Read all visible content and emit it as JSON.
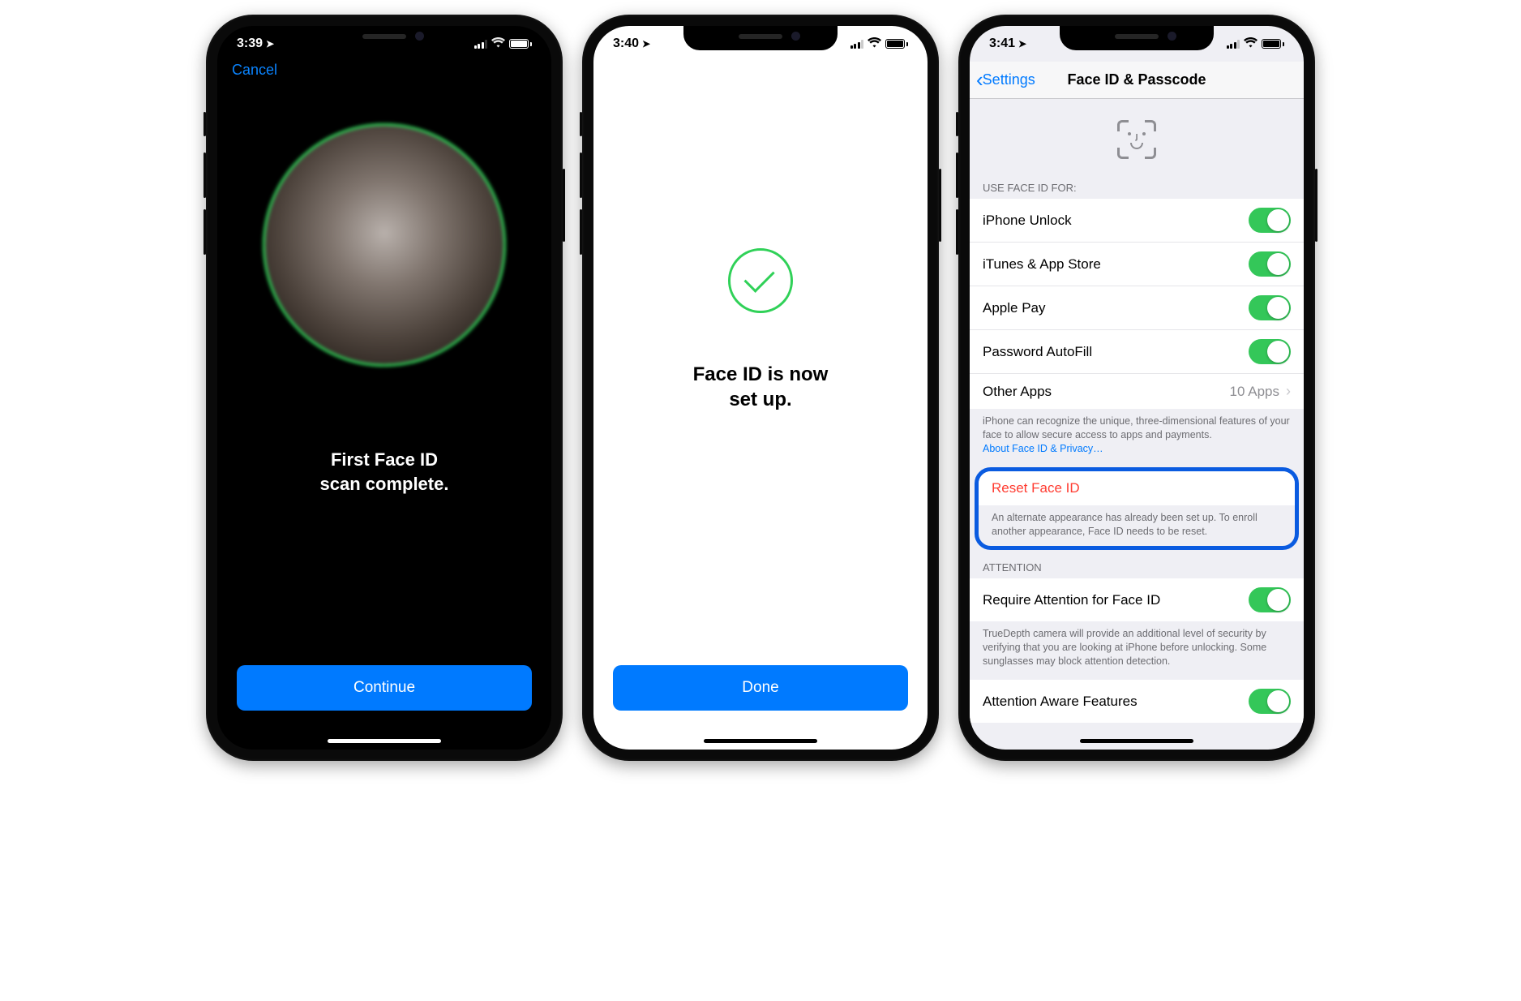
{
  "screen1": {
    "time": "3:39",
    "cancel": "Cancel",
    "scan_line1": "First Face ID",
    "scan_line2": "scan complete.",
    "continue_btn": "Continue"
  },
  "screen2": {
    "time": "3:40",
    "setup_line1": "Face ID is now",
    "setup_line2": "set up.",
    "done_btn": "Done"
  },
  "screen3": {
    "time": "3:41",
    "back": "Settings",
    "title": "Face ID & Passcode",
    "section_use": "USE FACE ID FOR:",
    "rows": {
      "unlock": "iPhone Unlock",
      "itunes": "iTunes & App Store",
      "applepay": "Apple Pay",
      "autofill": "Password AutoFill",
      "other": "Other Apps",
      "other_value": "10 Apps"
    },
    "footer1_text": "iPhone can recognize the unique, three-dimensional features of your face to allow secure access to apps and payments.",
    "footer1_link": "About Face ID & Privacy…",
    "reset": "Reset Face ID",
    "reset_footer": "An alternate appearance has already been set up. To enroll another appearance, Face ID needs to be reset.",
    "section_attention": "ATTENTION",
    "require_attention": "Require Attention for Face ID",
    "attention_footer": "TrueDepth camera will provide an additional level of security by verifying that you are looking at iPhone before unlocking. Some sunglasses may block attention detection.",
    "aware": "Attention Aware Features"
  }
}
